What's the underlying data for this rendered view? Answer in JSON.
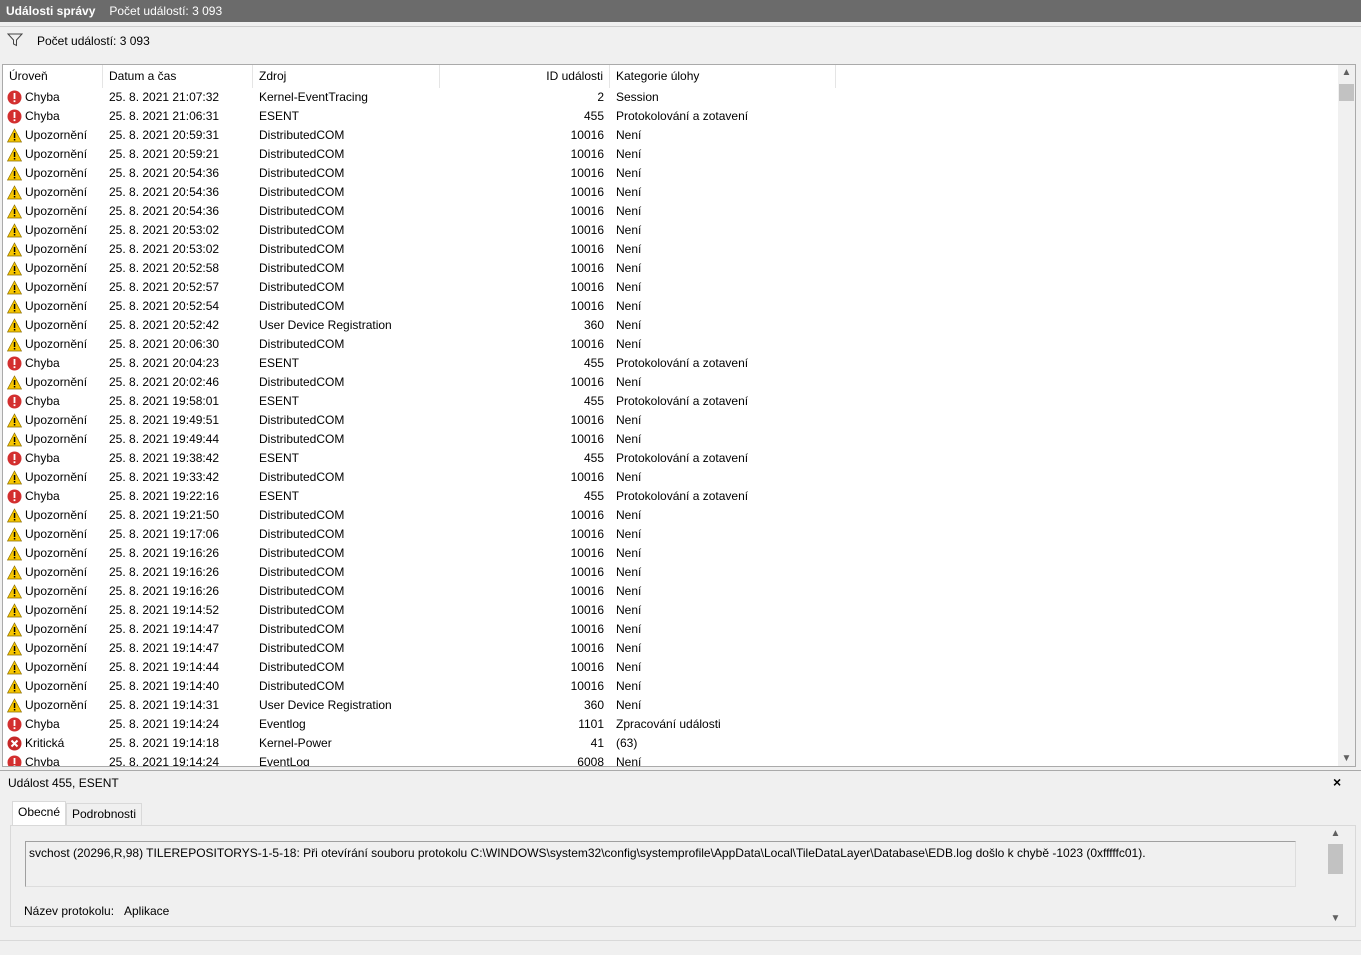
{
  "titlebar": {
    "title": "Události správy",
    "count": "Počet událostí: 3 093"
  },
  "filter": {
    "icon": "filter-icon",
    "text": "Počet událostí: 3 093"
  },
  "columns": [
    "Úroveň",
    "Datum a čas",
    "Zdroj",
    "ID události",
    "Kategorie úlohy"
  ],
  "levels": {
    "Chyba": {
      "icon": "error-icon",
      "color": "#d32f2f"
    },
    "Upozornění": {
      "icon": "warning-icon",
      "color": "#f7c600"
    },
    "Kritická": {
      "icon": "critical-icon",
      "color": "#c62828"
    }
  },
  "rows": [
    [
      "Chyba",
      "25. 8. 2021 21:07:32",
      "Kernel-EventTracing",
      "2",
      "Session"
    ],
    [
      "Chyba",
      "25. 8. 2021 21:06:31",
      "ESENT",
      "455",
      "Protokolování a zotavení"
    ],
    [
      "Upozornění",
      "25. 8. 2021 20:59:31",
      "DistributedCOM",
      "10016",
      "Není"
    ],
    [
      "Upozornění",
      "25. 8. 2021 20:59:21",
      "DistributedCOM",
      "10016",
      "Není"
    ],
    [
      "Upozornění",
      "25. 8. 2021 20:54:36",
      "DistributedCOM",
      "10016",
      "Není"
    ],
    [
      "Upozornění",
      "25. 8. 2021 20:54:36",
      "DistributedCOM",
      "10016",
      "Není"
    ],
    [
      "Upozornění",
      "25. 8. 2021 20:54:36",
      "DistributedCOM",
      "10016",
      "Není"
    ],
    [
      "Upozornění",
      "25. 8. 2021 20:53:02",
      "DistributedCOM",
      "10016",
      "Není"
    ],
    [
      "Upozornění",
      "25. 8. 2021 20:53:02",
      "DistributedCOM",
      "10016",
      "Není"
    ],
    [
      "Upozornění",
      "25. 8. 2021 20:52:58",
      "DistributedCOM",
      "10016",
      "Není"
    ],
    [
      "Upozornění",
      "25. 8. 2021 20:52:57",
      "DistributedCOM",
      "10016",
      "Není"
    ],
    [
      "Upozornění",
      "25. 8. 2021 20:52:54",
      "DistributedCOM",
      "10016",
      "Není"
    ],
    [
      "Upozornění",
      "25. 8. 2021 20:52:42",
      "User Device Registration",
      "360",
      "Není"
    ],
    [
      "Upozornění",
      "25. 8. 2021 20:06:30",
      "DistributedCOM",
      "10016",
      "Není"
    ],
    [
      "Chyba",
      "25. 8. 2021 20:04:23",
      "ESENT",
      "455",
      "Protokolování a zotavení"
    ],
    [
      "Upozornění",
      "25. 8. 2021 20:02:46",
      "DistributedCOM",
      "10016",
      "Není"
    ],
    [
      "Chyba",
      "25. 8. 2021 19:58:01",
      "ESENT",
      "455",
      "Protokolování a zotavení"
    ],
    [
      "Upozornění",
      "25. 8. 2021 19:49:51",
      "DistributedCOM",
      "10016",
      "Není"
    ],
    [
      "Upozornění",
      "25. 8. 2021 19:49:44",
      "DistributedCOM",
      "10016",
      "Není"
    ],
    [
      "Chyba",
      "25. 8. 2021 19:38:42",
      "ESENT",
      "455",
      "Protokolování a zotavení"
    ],
    [
      "Upozornění",
      "25. 8. 2021 19:33:42",
      "DistributedCOM",
      "10016",
      "Není"
    ],
    [
      "Chyba",
      "25. 8. 2021 19:22:16",
      "ESENT",
      "455",
      "Protokolování a zotavení"
    ],
    [
      "Upozornění",
      "25. 8. 2021 19:21:50",
      "DistributedCOM",
      "10016",
      "Není"
    ],
    [
      "Upozornění",
      "25. 8. 2021 19:17:06",
      "DistributedCOM",
      "10016",
      "Není"
    ],
    [
      "Upozornění",
      "25. 8. 2021 19:16:26",
      "DistributedCOM",
      "10016",
      "Není"
    ],
    [
      "Upozornění",
      "25. 8. 2021 19:16:26",
      "DistributedCOM",
      "10016",
      "Není"
    ],
    [
      "Upozornění",
      "25. 8. 2021 19:16:26",
      "DistributedCOM",
      "10016",
      "Není"
    ],
    [
      "Upozornění",
      "25. 8. 2021 19:14:52",
      "DistributedCOM",
      "10016",
      "Není"
    ],
    [
      "Upozornění",
      "25. 8. 2021 19:14:47",
      "DistributedCOM",
      "10016",
      "Není"
    ],
    [
      "Upozornění",
      "25. 8. 2021 19:14:47",
      "DistributedCOM",
      "10016",
      "Není"
    ],
    [
      "Upozornění",
      "25. 8. 2021 19:14:44",
      "DistributedCOM",
      "10016",
      "Není"
    ],
    [
      "Upozornění",
      "25. 8. 2021 19:14:40",
      "DistributedCOM",
      "10016",
      "Není"
    ],
    [
      "Upozornění",
      "25. 8. 2021 19:14:31",
      "User Device Registration",
      "360",
      "Není"
    ],
    [
      "Chyba",
      "25. 8. 2021 19:14:24",
      "Eventlog",
      "1101",
      "Zpracování události"
    ],
    [
      "Kritická",
      "25. 8. 2021 19:14:18",
      "Kernel-Power",
      "41",
      "(63)"
    ],
    [
      "Chyba",
      "25. 8. 2021 19:14:24",
      "EventLog",
      "6008",
      "Není"
    ]
  ],
  "detail": {
    "header": "Událost 455, ESENT",
    "close": "×",
    "tabs": [
      "Obecné",
      "Podrobnosti"
    ],
    "message": "svchost (20296,R,98) TILEREPOSITORYS-1-5-18: Při otevírání souboru protokolu C:\\WINDOWS\\system32\\config\\systemprofile\\AppData\\Local\\TileDataLayer\\Database\\EDB.log došlo k chybě -1023 (0xfffffc01).",
    "log_label": "Název protokolu:",
    "log_value": "Aplikace"
  }
}
